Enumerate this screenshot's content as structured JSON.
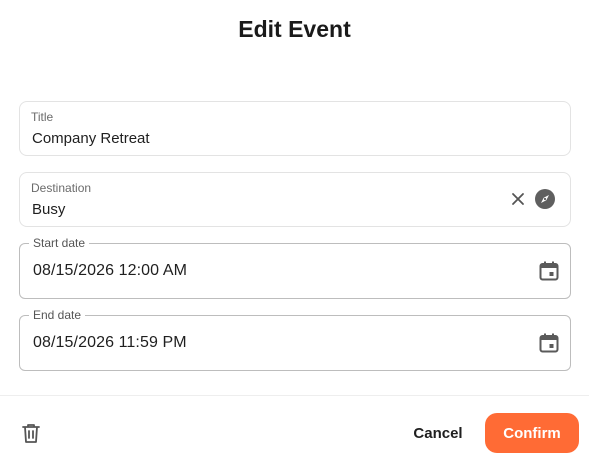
{
  "dialog": {
    "title": "Edit Event"
  },
  "fields": {
    "title": {
      "label": "Title",
      "value": "Company Retreat"
    },
    "destination": {
      "label": "Destination",
      "value": "Busy"
    },
    "start_date": {
      "label": "Start date",
      "value": "08/15/2026 12:00 AM"
    },
    "end_date": {
      "label": "End date",
      "value": "08/15/2026 11:59 PM"
    }
  },
  "icons": {
    "clear": "close-icon",
    "navigate": "compass-icon",
    "calendar": "calendar-icon",
    "delete": "trash-icon"
  },
  "actions": {
    "cancel_label": "Cancel",
    "confirm_label": "Confirm"
  },
  "colors": {
    "accent": "#ff6b35"
  }
}
